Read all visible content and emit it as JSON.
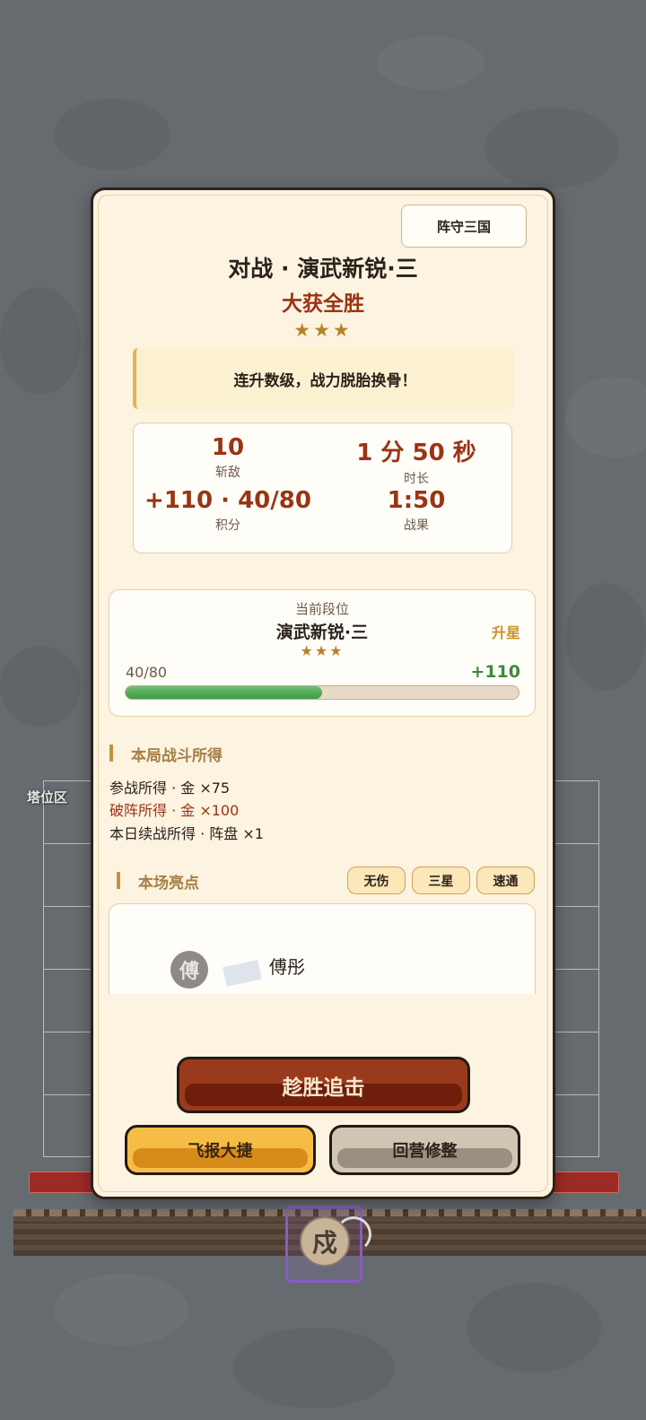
{
  "background": {
    "zone_label": "塔位区",
    "unit_glyph": "戍"
  },
  "dialog": {
    "mode_tag": "阵守三国",
    "battle_title": "对战 · 演武新锐·三",
    "result": "大获全胜",
    "result_stars": "★★★",
    "banner": "连升数级，战力脱胎换骨！",
    "stats": [
      {
        "value": "10",
        "label": "斩敌"
      },
      {
        "value": "1 分 50 秒",
        "label": "时长"
      },
      {
        "value": "+110 · 40/80",
        "label": "积分"
      },
      {
        "value": "1:50",
        "label": "战果"
      }
    ],
    "rank": {
      "caption": "当前段位",
      "name": "演武新锐·三",
      "stars": "★★★",
      "status": "升星",
      "progress_text": "40/80",
      "progress_fraction": 0.5,
      "gain": "+110"
    },
    "rewards": {
      "title": "本局战斗所得",
      "items": [
        {
          "text": "参战所得 · 金 ×75",
          "highlight": false
        },
        {
          "text": "破阵所得 · 金 ×100",
          "highlight": true
        },
        {
          "text": "本日续战所得 · 阵盘 ×1",
          "highlight": false
        }
      ]
    },
    "highlights": {
      "title": "本场亮点",
      "badges": [
        "无伤",
        "三星",
        "速通"
      ],
      "hero_avatar": "傅",
      "hero_name": "傅彤"
    },
    "buttons": {
      "pursue": "趁胜追击",
      "report": "飞报大捷",
      "camp": "回营修整"
    }
  },
  "colors": {
    "accent_red": "#9a3414",
    "gold": "#b8822c",
    "progress_green": "#3f9a45",
    "panel_bg": "#fcf3e0"
  }
}
